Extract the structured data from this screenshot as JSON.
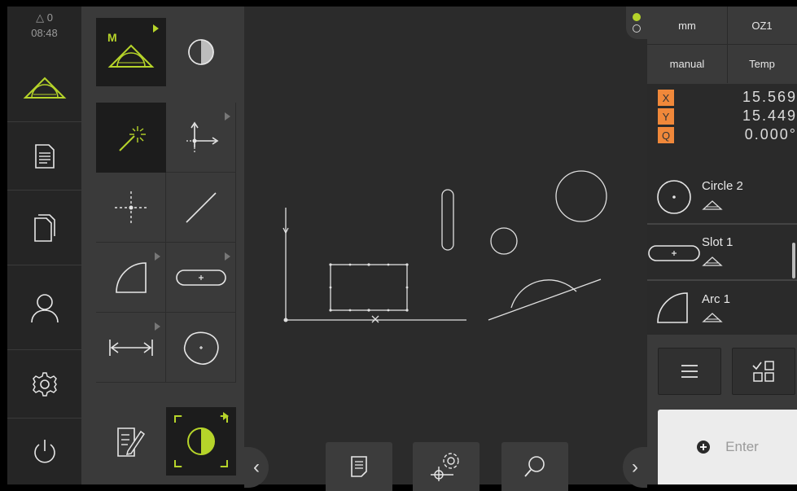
{
  "nav": {
    "status_triangle": "△",
    "status_count": "0",
    "time": "08:48",
    "items": [
      {
        "name": "measure",
        "icon": "measure-triangle-icon"
      },
      {
        "name": "report",
        "icon": "report-document-icon"
      },
      {
        "name": "file-management",
        "icon": "files-icon"
      },
      {
        "name": "user",
        "icon": "user-icon"
      },
      {
        "name": "settings",
        "icon": "gear-icon"
      },
      {
        "name": "power",
        "icon": "power-icon"
      }
    ]
  },
  "palette": {
    "measure_mode_label": "M",
    "tools": [
      "measure-manual-icon",
      "contrast-icon",
      "auto-detect-wand-icon",
      "coordinate-axes-icon",
      "point-crosshair-icon",
      "line-icon",
      "arc-icon",
      "slot-icon",
      "distance-icon",
      "blob-icon",
      "notes-edit-icon",
      "contrast-active-icon"
    ]
  },
  "canvas": {
    "bottom_buttons": [
      "report-icon",
      "view-settings-icon",
      "zoom-icon"
    ],
    "left_arrow": "‹",
    "right_arrow": "›"
  },
  "header": {
    "unit": "mm",
    "zero_point": "OZ1",
    "mode": "manual",
    "temp": "Temp"
  },
  "positions": [
    {
      "axis": "X",
      "value": "15.569"
    },
    {
      "axis": "Y",
      "value": "15.449"
    },
    {
      "axis": "Q",
      "value": "0.000°"
    }
  ],
  "features": [
    {
      "name": "Circle 2",
      "icon": "circle-feature-icon"
    },
    {
      "name": "Slot 1",
      "icon": "slot-feature-icon"
    },
    {
      "name": "Arc 1",
      "icon": "arc-feature-icon"
    }
  ],
  "actions": {
    "enter_label": "Enter"
  },
  "colors": {
    "accent_green": "#b6d42a",
    "orange": "#f0883a"
  }
}
